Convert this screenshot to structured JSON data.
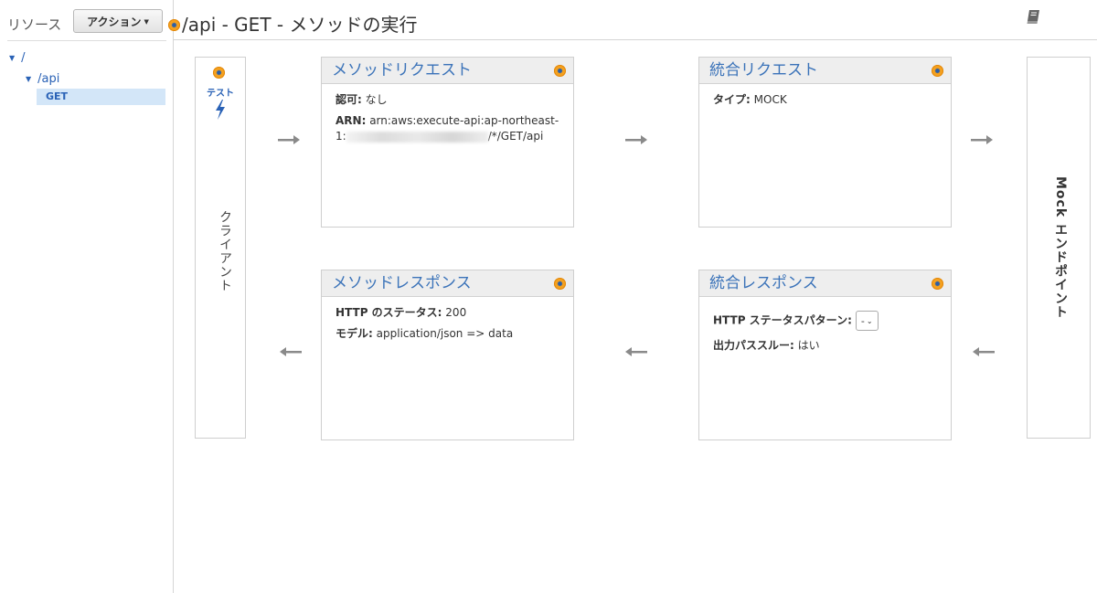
{
  "sidebar": {
    "title": "リソース",
    "action_button": "アクション",
    "tree": [
      {
        "label": "/"
      },
      {
        "label": "/api"
      },
      {
        "label": "GET"
      }
    ]
  },
  "header": {
    "title": "/api - GET - メソッドの実行",
    "book_icon": "book-icon"
  },
  "client": {
    "test_label": "テスト",
    "label": "クライアント"
  },
  "mock": {
    "label": "Mock エンドポイント"
  },
  "method_request": {
    "title": "メソッドリクエスト",
    "auth_label": "認可:",
    "auth_value": "なし",
    "arn_label": "ARN:",
    "arn_prefix": "arn:aws:execute-api:ap-northeast-",
    "arn_line2_start": "1:",
    "arn_line2_end": "/*/GET/api"
  },
  "integration_request": {
    "title": "統合リクエスト",
    "type_label": "タイプ:",
    "type_value": "MOCK"
  },
  "method_response": {
    "title": "メソッドレスポンス",
    "status_label": "HTTP のステータス:",
    "status_value": "200",
    "model_label": "モデル:",
    "model_value": "application/json => data"
  },
  "integration_response": {
    "title": "統合レスポンス",
    "pattern_label": "HTTP ステータスパターン:",
    "pattern_value": "-",
    "passthrough_label": "出力パススルー:",
    "passthrough_value": "はい"
  },
  "colors": {
    "accent": "#f5a11f",
    "link": "#2a62b6",
    "title": "#3b73b9"
  }
}
